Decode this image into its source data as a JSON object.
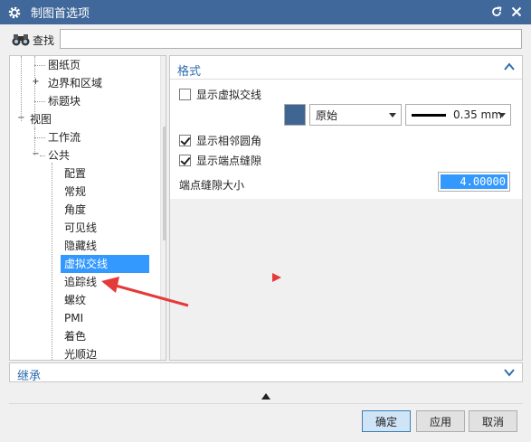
{
  "window": {
    "title": "制图首选项",
    "accent_color": "#41689a"
  },
  "search": {
    "label": "查找",
    "value": "",
    "placeholder": ""
  },
  "tree": {
    "items": [
      {
        "label": "图纸页",
        "level": 2
      },
      {
        "label": "边界和区域",
        "level": 2,
        "toggle": "+"
      },
      {
        "label": "标题块",
        "level": 2
      },
      {
        "label": "视图",
        "level": 1,
        "toggle": "−"
      },
      {
        "label": "工作流",
        "level": 2
      },
      {
        "label": "公共",
        "level": 2,
        "toggle": "−"
      },
      {
        "label": "配置",
        "level": 3
      },
      {
        "label": "常规",
        "level": 3
      },
      {
        "label": "角度",
        "level": 3
      },
      {
        "label": "可见线",
        "level": 3
      },
      {
        "label": "隐藏线",
        "level": 3
      },
      {
        "label": "虚拟交线",
        "level": 3,
        "selected": true
      },
      {
        "label": "追踪线",
        "level": 3
      },
      {
        "label": "螺纹",
        "level": 3
      },
      {
        "label": "PMI",
        "level": 3
      },
      {
        "label": "着色",
        "level": 3
      },
      {
        "label": "光顺边",
        "level": 3
      }
    ],
    "selected_color": "#3399ff"
  },
  "format_section": {
    "title": "格式",
    "show_virtual_intersection": {
      "label": "显示虚拟交线",
      "checked": false
    },
    "color_swatch": "#3f6593",
    "linetype_value": "原始",
    "line_width_value": "0.35 mm",
    "show_adjacent_fillets": {
      "label": "显示相邻圆角",
      "checked": true
    },
    "show_endpoint_gaps": {
      "label": "显示端点缝隙",
      "checked": true
    },
    "gap_size_label": "端点缝隙大小",
    "gap_size_value": "4.00000"
  },
  "inherit_section": {
    "title": "继承"
  },
  "buttons": {
    "ok": "确定",
    "apply": "应用",
    "cancel": "取消"
  },
  "annotation": {
    "arrow_color": "#e53a3a"
  }
}
